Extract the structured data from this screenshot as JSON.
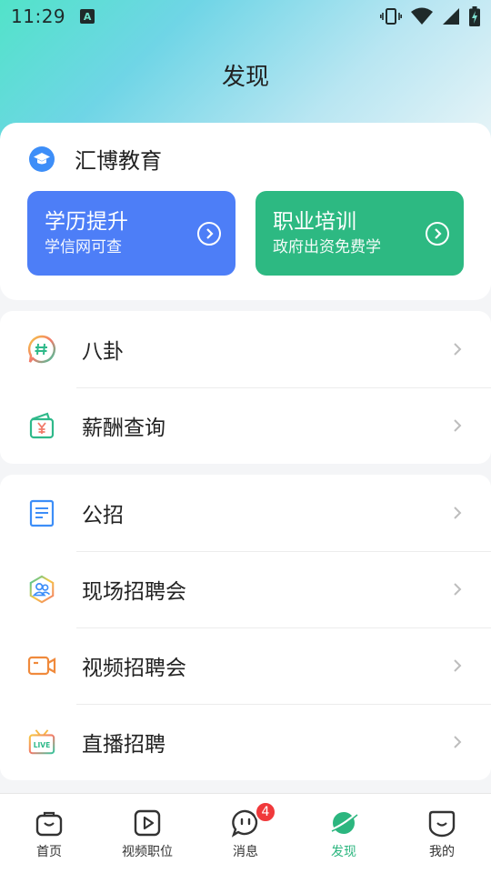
{
  "status_bar": {
    "time": "11:29",
    "notification_letter": "A"
  },
  "page": {
    "title": "发现"
  },
  "education": {
    "title": "汇博教育",
    "cards": [
      {
        "title": "学历提升",
        "subtitle": "学信网可查",
        "color": "#4d7ef7"
      },
      {
        "title": "职业培训",
        "subtitle": "政府出资免费学",
        "color": "#2db982"
      }
    ]
  },
  "list_group_1": [
    {
      "label": "八卦",
      "icon": "gossip-icon"
    },
    {
      "label": "薪酬查询",
      "icon": "salary-wallet-icon"
    }
  ],
  "list_group_2": [
    {
      "label": "公招",
      "icon": "document-icon"
    },
    {
      "label": "现场招聘会",
      "icon": "people-hexagon-icon"
    },
    {
      "label": "视频招聘会",
      "icon": "video-camera-icon"
    },
    {
      "label": "直播招聘",
      "icon": "live-tv-icon"
    }
  ],
  "tabbar": {
    "tabs": [
      {
        "label": "首页",
        "icon": "home-bag-icon"
      },
      {
        "label": "视频职位",
        "icon": "video-play-icon"
      },
      {
        "label": "消息",
        "icon": "message-icon",
        "badge": "4"
      },
      {
        "label": "发现",
        "icon": "discover-planet-icon",
        "active": true
      },
      {
        "label": "我的",
        "icon": "profile-face-icon"
      }
    ]
  },
  "colors": {
    "accent": "#2cb67f",
    "badge": "#f0393b"
  }
}
